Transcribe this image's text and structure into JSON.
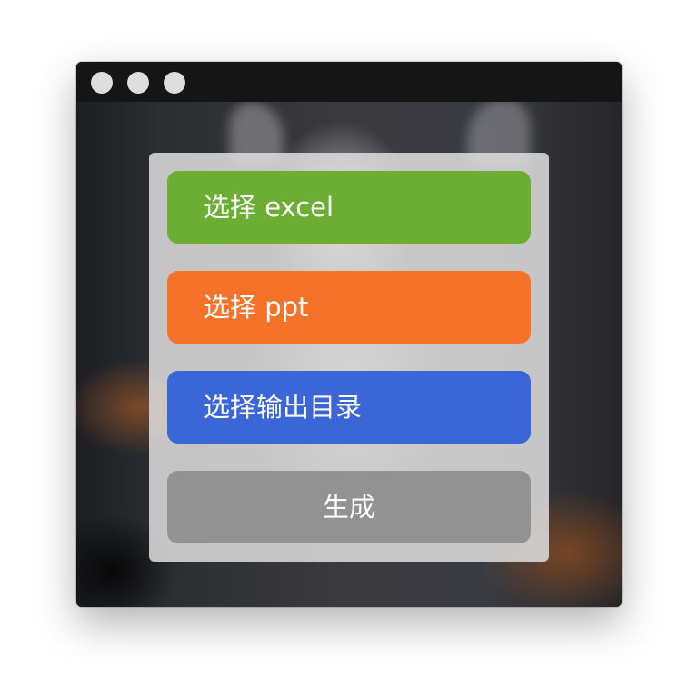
{
  "window": {
    "controls": [
      "close",
      "minimize",
      "maximize"
    ]
  },
  "buttons": {
    "select_excel": "选择 excel",
    "select_ppt": "选择 ppt",
    "select_output_dir": "选择输出目录",
    "generate": "生成"
  },
  "colors": {
    "excel": "#6cae33",
    "ppt": "#f57228",
    "output_dir": "#3a66d8",
    "generate": "#929292",
    "titlebar": "#151515",
    "panel": "#dedede"
  }
}
